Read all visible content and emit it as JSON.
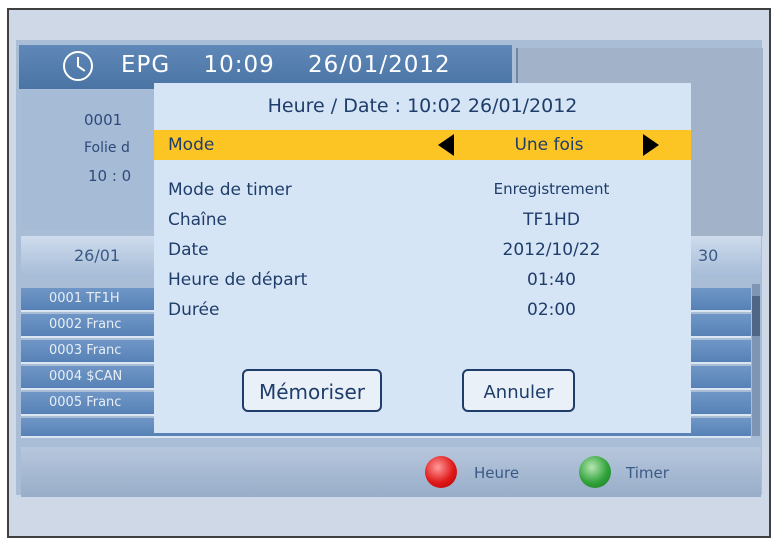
{
  "header": {
    "app": "EPG",
    "time": "10:09",
    "date": "26/01/2012"
  },
  "info": {
    "channel_number": "0001",
    "program": "Folie d",
    "time": "10 : 0"
  },
  "day_bar": {
    "left": "26/01",
    "right": "30"
  },
  "channel_list": [
    {
      "label": "0001 TF1H"
    },
    {
      "label": "0002 Franc"
    },
    {
      "label": "0003 Franc"
    },
    {
      "label": "0004 $CAN"
    },
    {
      "label": "0005 Franc"
    }
  ],
  "footer": {
    "red_label": "Heure",
    "green_label": "Timer",
    "red_color": "#e01919",
    "green_color": "#32a33c"
  },
  "dialog": {
    "title": "Heure / Date : 10:02  26/01/2012",
    "mode": {
      "label": "Mode",
      "value": "Une fois"
    },
    "fields": [
      {
        "label": "Mode de timer",
        "value": "Enregistrement"
      },
      {
        "label": "Chaîne",
        "value": "TF1HD"
      },
      {
        "label": "Date",
        "value": "2012/10/22"
      },
      {
        "label": "Heure de départ",
        "value": "01:40"
      },
      {
        "label": "Durée",
        "value": "02:00"
      }
    ],
    "buttons": {
      "save": "Mémoriser",
      "cancel": "Annuler"
    },
    "highlight_color": "#fdc524"
  }
}
